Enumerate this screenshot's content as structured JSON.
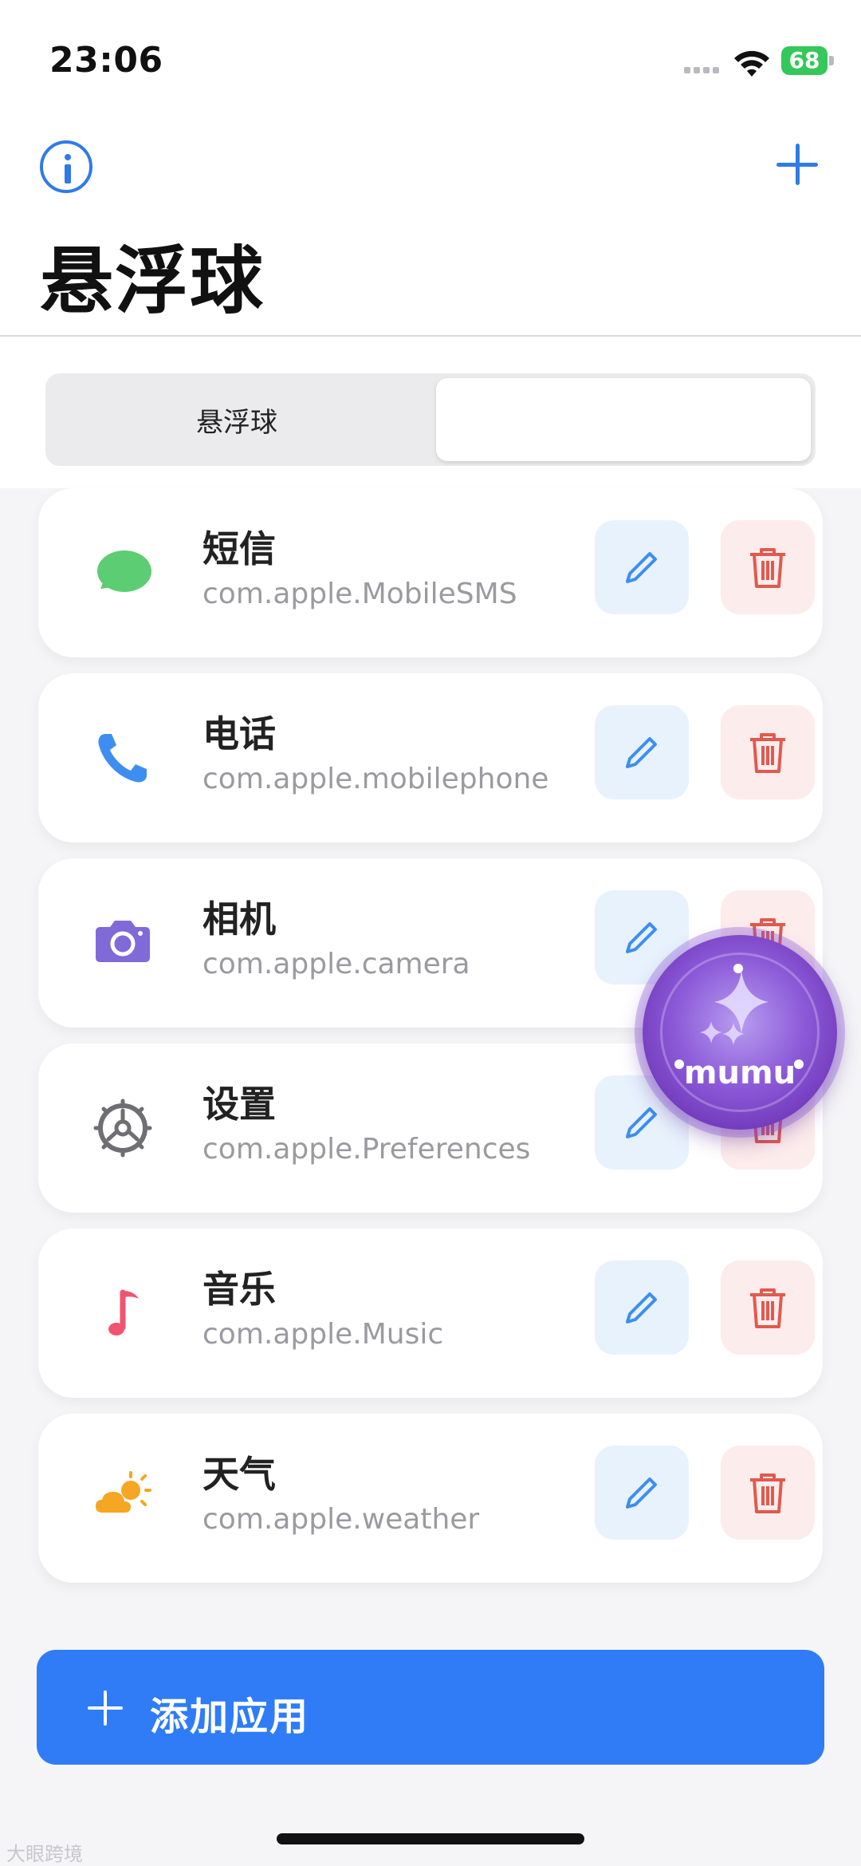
{
  "status_bar": {
    "time": "23:06",
    "battery": "68"
  },
  "header": {
    "title": "悬浮球"
  },
  "segmented": {
    "options": [
      "悬浮球",
      ""
    ],
    "selected_index": 1
  },
  "apps": [
    {
      "name": "短信",
      "bundle": "com.apple.MobileSMS",
      "icon": "message-bubble-icon",
      "color": "#5ccd72"
    },
    {
      "name": "电话",
      "bundle": "com.apple.mobilephone",
      "icon": "phone-icon",
      "color": "#3d8ef0"
    },
    {
      "name": "相机",
      "bundle": "com.apple.camera",
      "icon": "camera-icon",
      "color": "#7f6ad8"
    },
    {
      "name": "设置",
      "bundle": "com.apple.Preferences",
      "icon": "settings-gear-icon",
      "color": "#6e6e73"
    },
    {
      "name": "音乐",
      "bundle": "com.apple.Music",
      "icon": "music-note-icon",
      "color": "#f05470"
    },
    {
      "name": "天气",
      "bundle": "com.apple.weather",
      "icon": "weather-icon",
      "color": "#f5a623"
    }
  ],
  "actions": {
    "add_app_label": "添加应用"
  },
  "floating_ball": {
    "label": "mumu"
  },
  "watermark": "大眼跨境",
  "colors": {
    "accent": "#2f7cf6",
    "edit_bg": "#e8f2fd",
    "delete_bg": "#fdecec",
    "delete_icon": "#e05a4f"
  }
}
